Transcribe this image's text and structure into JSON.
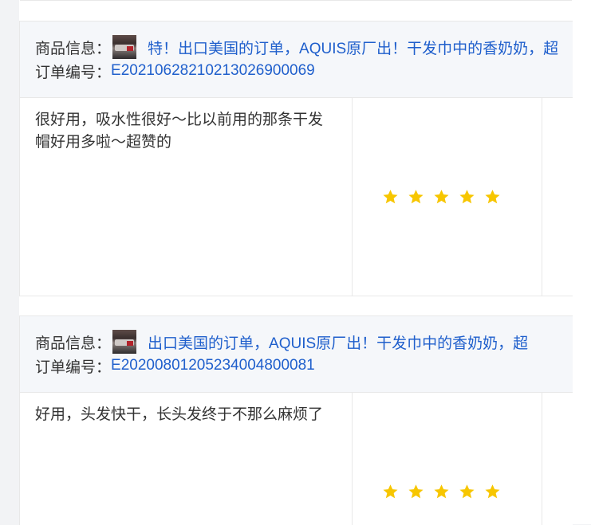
{
  "reviews": [
    {
      "product_label": "商品信息：",
      "product_title": "特！出口美国的订单，AQUIS原厂出！干发巾中的香奶奶，超",
      "order_label": "订单编号：",
      "order_number": "E20210628210213026900069",
      "comment": " 很好用，吸水性很好～比以前用的那条干发帽好用多啦～超赞的",
      "rating": 5,
      "thumbnail_icon": "product-thumbnail-image"
    },
    {
      "product_label": "商品信息：",
      "product_title": "出口美国的订单，AQUIS原厂出！干发巾中的香奶奶，超",
      "order_label": "订单编号：",
      "order_number": "E20200801205234004800081",
      "comment": " 好用，头发快干，长头发终于不那么麻烦了",
      "rating": 5,
      "thumbnail_icon": "product-thumbnail-image"
    }
  ],
  "colors": {
    "link": "#1f5fcc",
    "star": "#f7c600",
    "header_bg": "#f5f7fa",
    "border": "#e8e8e8"
  }
}
